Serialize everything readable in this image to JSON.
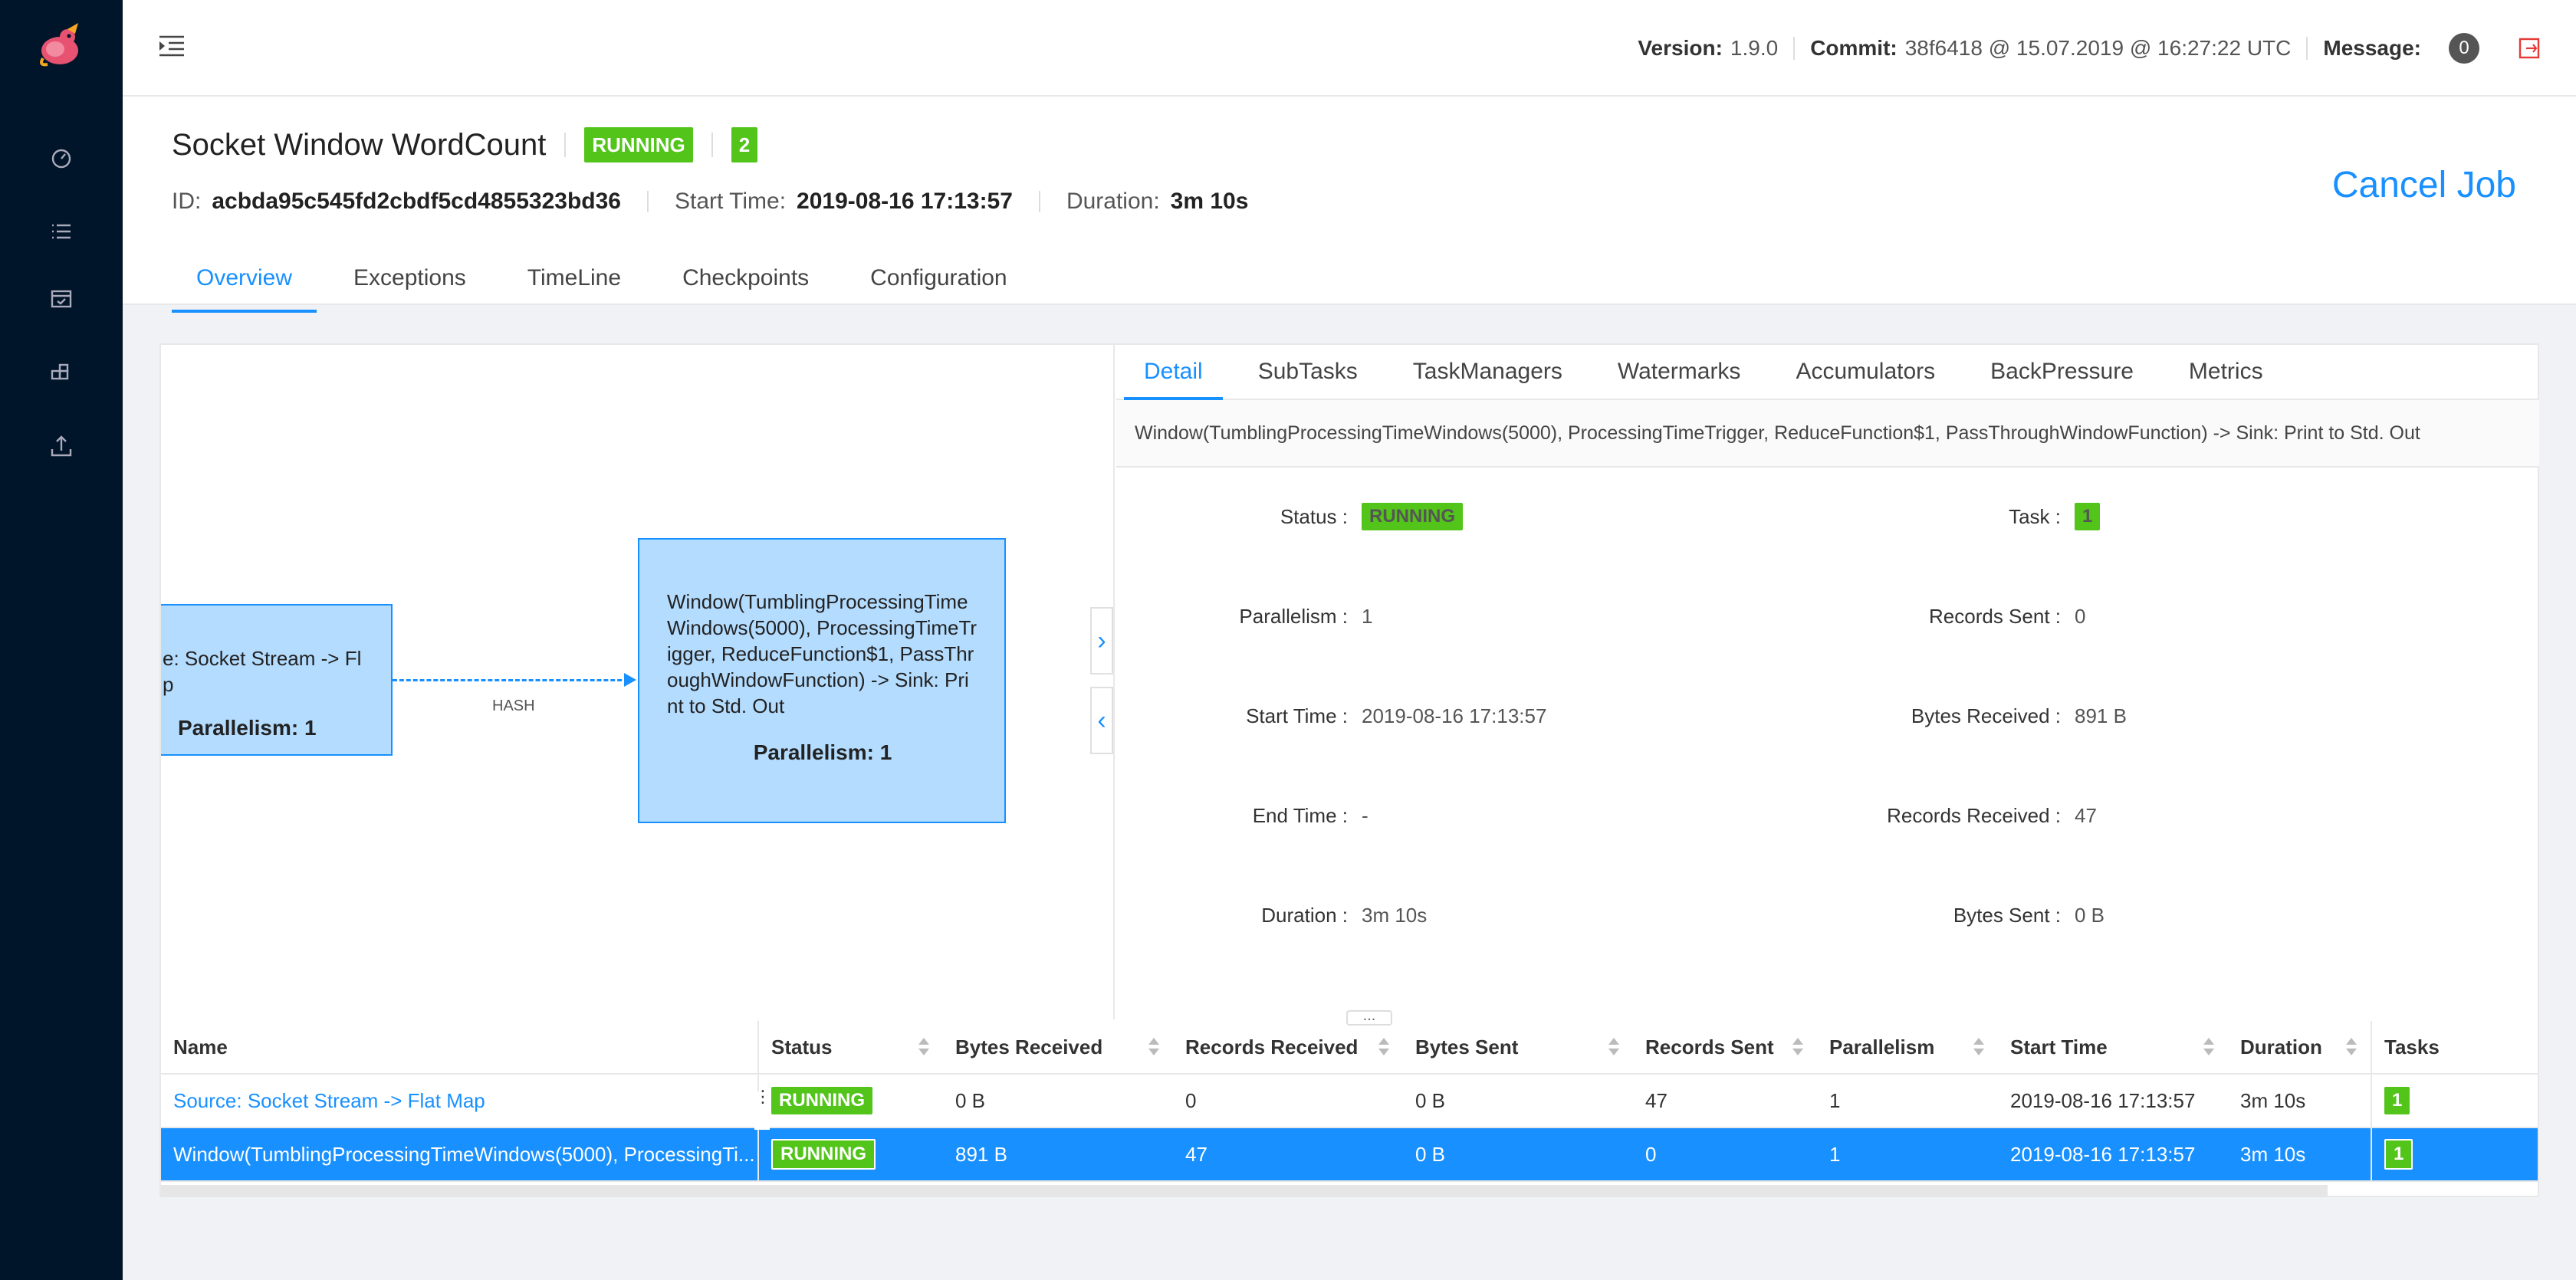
{
  "header": {
    "version_label": "Version:",
    "version": "1.9.0",
    "commit_label": "Commit:",
    "commit": "38f6418 @ 15.07.2019 @ 16:27:22 UTC",
    "message_label": "Message:",
    "message_count": "0"
  },
  "job": {
    "title": "Socket Window WordCount",
    "status": "RUNNING",
    "count": "2",
    "id_label": "ID:",
    "id": "acbda95c545fd2cbdf5cd4855323bd36",
    "start_label": "Start Time:",
    "start_time": "2019-08-16 17:13:57",
    "duration_label": "Duration:",
    "duration": "3m 10s",
    "cancel_label": "Cancel Job",
    "tabs": [
      "Overview",
      "Exceptions",
      "TimeLine",
      "Checkpoints",
      "Configuration"
    ]
  },
  "graph": {
    "node1": {
      "text": "e: Socket Stream -> Fl\np",
      "parallelism": "Parallelism: 1"
    },
    "node2": {
      "text": "Window(TumblingProcessingTimeWindows(5000), ProcessingTimeTrigger, ReduceFunction$1, PassThroughWindowFunction) -> Sink: Print to Std. Out",
      "parallelism": "Parallelism: 1"
    },
    "edge_label": "HASH"
  },
  "detail": {
    "tabs": [
      "Detail",
      "SubTasks",
      "TaskManagers",
      "Watermarks",
      "Accumulators",
      "BackPressure",
      "Metrics"
    ],
    "vertex_name": "Window(TumblingProcessingTimeWindows(5000), ProcessingTimeTrigger, ReduceFunction$1, PassThroughWindowFunction) -> Sink: Print to Std. Out",
    "status_label": "Status :",
    "status": "RUNNING",
    "task_label": "Task :",
    "task": "1",
    "parallelism_label": "Parallelism :",
    "parallelism": "1",
    "records_sent_label": "Records Sent :",
    "records_sent": "0",
    "start_time_label": "Start Time :",
    "start_time": "2019-08-16 17:13:57",
    "bytes_received_label": "Bytes Received :",
    "bytes_received": "891 B",
    "end_time_label": "End Time :",
    "end_time": "-",
    "records_received_label": "Records Received :",
    "records_received": "47",
    "duration_label": "Duration :",
    "duration": "3m 10s",
    "bytes_sent_label": "Bytes Sent :",
    "bytes_sent": "0 B"
  },
  "table": {
    "columns": [
      "Name",
      "Status",
      "Bytes Received",
      "Records Received",
      "Bytes Sent",
      "Records Sent",
      "Parallelism",
      "Start Time",
      "Duration",
      "Tasks"
    ],
    "rows": [
      {
        "name": "Source: Socket Stream -> Flat Map",
        "status": "RUNNING",
        "bytes_received": "0 B",
        "records_received": "0",
        "bytes_sent": "0 B",
        "records_sent": "47",
        "parallelism": "1",
        "start_time": "2019-08-16 17:13:57",
        "duration": "3m 10s",
        "tasks": "1"
      },
      {
        "name": "Window(TumblingProcessingTimeWindows(5000), ProcessingTi...",
        "status": "RUNNING",
        "bytes_received": "891 B",
        "records_received": "47",
        "bytes_sent": "0 B",
        "records_sent": "0",
        "parallelism": "1",
        "start_time": "2019-08-16 17:13:57",
        "duration": "3m 10s",
        "tasks": "1"
      }
    ]
  },
  "colors": {
    "accent": "#1890ff",
    "running": "#52c41a",
    "sidebar": "#001529"
  }
}
